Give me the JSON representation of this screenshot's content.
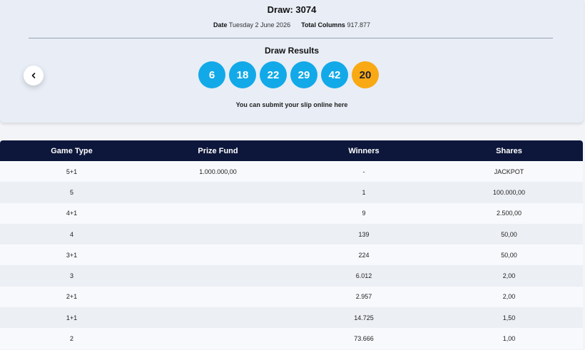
{
  "draw": {
    "title": "Draw: 3074",
    "date_label": "Date",
    "date_value": "Tuesday 2 June 2026",
    "columns_label": "Total Columns",
    "columns_value": "917.877"
  },
  "results": {
    "title": "Draw Results",
    "numbers": [
      "6",
      "18",
      "22",
      "29",
      "42"
    ],
    "bonus": "20",
    "submit_text": "You can submit your slip online here"
  },
  "icons": {
    "prev": "chevron-left-icon"
  },
  "colors": {
    "ball": "#12a9e8",
    "bonus_ball": "#f9a914",
    "table_header": "#0d173b"
  },
  "table": {
    "headers": [
      "Game Type",
      "Prize Fund",
      "Winners",
      "Shares"
    ],
    "rows": [
      [
        "5+1",
        "1.000.000,00",
        "-",
        "JACKPOT"
      ],
      [
        "5",
        "",
        "1",
        "100.000,00"
      ],
      [
        "4+1",
        "",
        "9",
        "2.500,00"
      ],
      [
        "4",
        "",
        "139",
        "50,00"
      ],
      [
        "3+1",
        "",
        "224",
        "50,00"
      ],
      [
        "3",
        "",
        "6.012",
        "2,00"
      ],
      [
        "2+1",
        "",
        "2.957",
        "2,00"
      ],
      [
        "1+1",
        "",
        "14.725",
        "1,50"
      ],
      [
        "2",
        "",
        "73.666",
        "1,00"
      ]
    ]
  }
}
